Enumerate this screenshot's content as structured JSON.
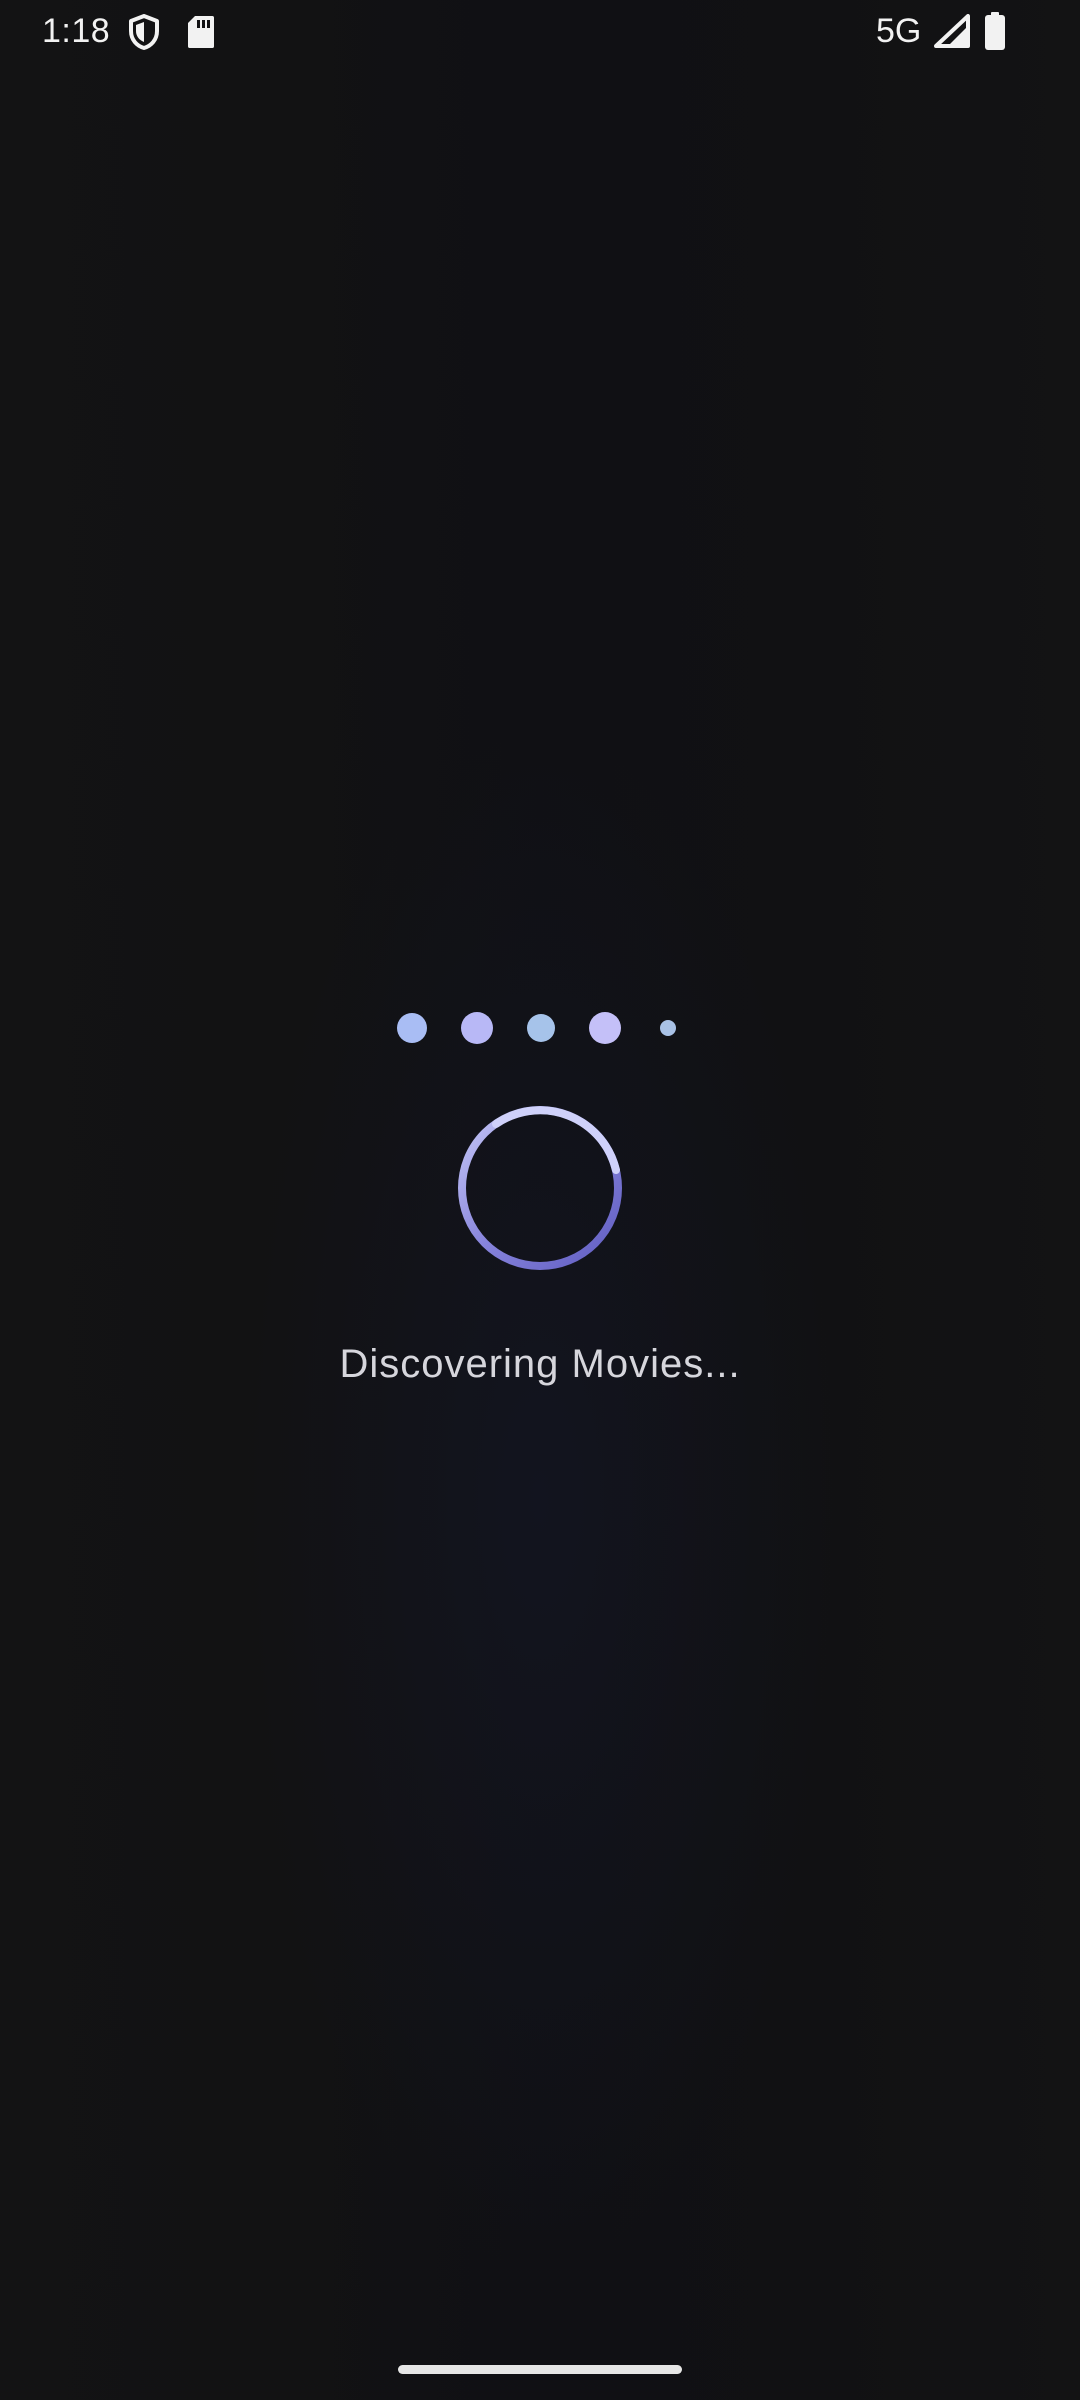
{
  "status_bar": {
    "time": "1:18",
    "network": "5G",
    "icons": [
      "shield-icon",
      "sdcard-icon",
      "signal-icon",
      "battery-icon"
    ]
  },
  "loader": {
    "message": "Discovering Movies...",
    "dot_colors": [
      "#a9bdf4",
      "#b8b8f6",
      "#a6c3ea",
      "#c4c0f8",
      "#a9c2e6"
    ],
    "spinner_color": "#6f6ccc",
    "spinner_highlight_color": "#c7c9f7"
  },
  "colors": {
    "background": "#121214",
    "text": "#d6d6dc"
  }
}
